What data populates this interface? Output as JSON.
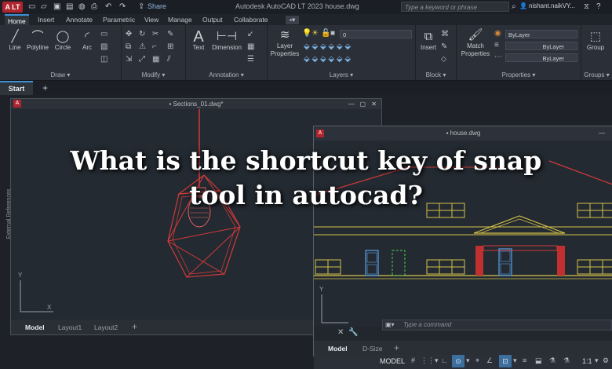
{
  "titlebar": {
    "app_badge": "A LT",
    "share_label": "Share",
    "title": "Autodesk AutoCAD LT 2023    house.dwg",
    "search_placeholder": "Type a keyword or phrase",
    "user_name": "nishant.naikVY..."
  },
  "ribbon_tabs": [
    "Home",
    "Insert",
    "Annotate",
    "Parametric",
    "View",
    "Manage",
    "Output",
    "Collaborate"
  ],
  "ribbon": {
    "draw": {
      "title": "Draw",
      "tools": [
        "Line",
        "Polyline",
        "Circle",
        "Arc"
      ]
    },
    "modify": {
      "title": "Modify"
    },
    "annotation": {
      "title": "Annotation",
      "tools": [
        "Text",
        "Dimension"
      ]
    },
    "layers": {
      "title": "Layers",
      "tool": "Layer Properties",
      "current_layer": "0"
    },
    "block": {
      "title": "Block",
      "tool": "Insert"
    },
    "properties": {
      "title": "Properties",
      "tool": "Match Properties",
      "color": "ByLayer",
      "linetype": "ByLayer",
      "lineweight": "ByLayer"
    },
    "groups": {
      "title": "Groups",
      "tool": "Group"
    }
  },
  "filetabs": {
    "start": "Start",
    "add": "+"
  },
  "windows": {
    "left": {
      "title": "Sections_01.dwg*",
      "side_label": "External References",
      "tabs": [
        "Model",
        "Layout1",
        "Layout2"
      ]
    },
    "right": {
      "title": "house.dwg",
      "tabs": [
        "Model",
        "D-Size"
      ],
      "command_placeholder": "Type a command"
    }
  },
  "statusbar": {
    "model": "MODEL",
    "scale": "1:1"
  },
  "headline": {
    "line1": "What is the shortcut key of snap",
    "line2": "tool in autocad?"
  },
  "colors": {
    "accent": "#3e8fd6",
    "brand_red": "#b0242e",
    "drawing_red": "#d23a3a",
    "drawing_yellow": "#d6c24a",
    "drawing_blue": "#5aa0e6",
    "drawing_green": "#3fb34f"
  }
}
